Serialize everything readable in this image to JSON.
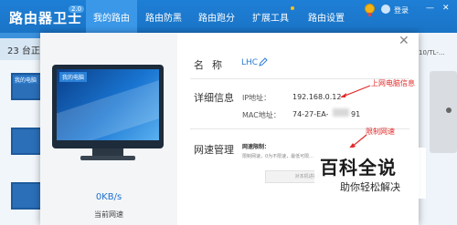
{
  "app": {
    "title": "路由器卫士",
    "version": "2.0"
  },
  "nav": {
    "items": [
      "我的路由",
      "路由防黑",
      "路由跑分",
      "扩展工具",
      "路由设置"
    ],
    "active": 0
  },
  "topright": {
    "login": "登录",
    "minimize": "—",
    "close": "✕"
  },
  "background": {
    "device_count": "23 台正",
    "device_label": "我的电脑",
    "right_text": "10/TL-..."
  },
  "dialog": {
    "screen_label": "我的电脑",
    "speed_value": "0KB/s",
    "speed_label": "当前网速",
    "name_label": "名称",
    "name_value": "LHC",
    "detail_label": "详细信息",
    "ip_key": "IP地址：",
    "ip_value": "192.168.0.12",
    "mac_key": "MAC地址：",
    "mac_value": "74-27-EA-",
    "mac_tail": "91",
    "netspeed_label": "网速管理",
    "limit_title": "网速限制：",
    "limit_desc": "限制网速，0为不限速，最低可限...",
    "limit_button": "对本机进行网速限制设..."
  },
  "annotations": {
    "ip_note": "上网电脑信息",
    "limit_note": "限制网速"
  },
  "watermark": {
    "big": "百科全说",
    "small": "助你轻松解决"
  },
  "colors": {
    "topbar": "#1e7fd6",
    "accent": "#2a7ad6",
    "annotation": "#e22b2b"
  }
}
